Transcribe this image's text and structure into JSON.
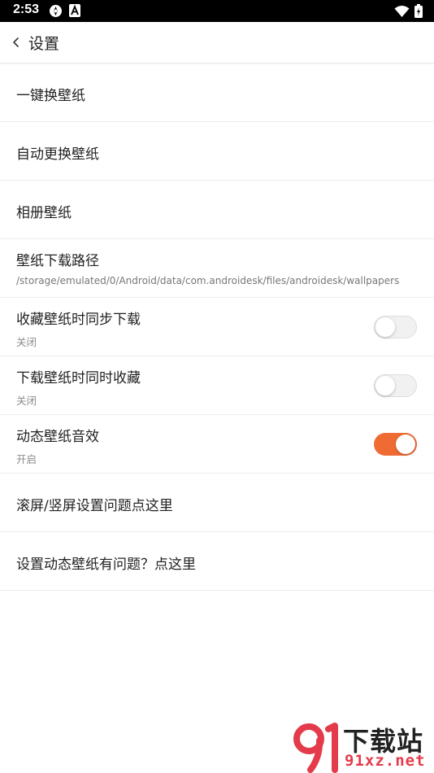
{
  "status_bar": {
    "time": "2:53",
    "left_icons": [
      "sync-icon",
      "app-a-icon"
    ],
    "right_icons": [
      "wifi-icon",
      "battery-charging-icon"
    ]
  },
  "header": {
    "title": "设置",
    "back_icon": "chevron-left-icon"
  },
  "settings": {
    "items": [
      {
        "title": "一键换壁纸"
      },
      {
        "title": "自动更换壁纸"
      },
      {
        "title": "相册壁纸"
      },
      {
        "title": "壁纸下载路径",
        "subtitle": "/storage/emulated/0/Android/data/com.androidesk/files/androidesk/wallpapers"
      },
      {
        "title": "收藏壁纸时同步下载",
        "subtitle": "关闭",
        "toggle": false
      },
      {
        "title": "下载壁纸时同时收藏",
        "subtitle": "关闭",
        "toggle": false
      },
      {
        "title": "动态壁纸音效",
        "subtitle": "开启",
        "toggle": true
      },
      {
        "title": "滚屏/竖屏设置问题点这里"
      },
      {
        "title": "设置动态壁纸有问题？点这里"
      }
    ]
  },
  "watermark": {
    "logo_text": "91",
    "title": "下载站",
    "url": "91xz.net"
  },
  "colors": {
    "accent": "#f06a34",
    "watermark_red": "#e43b4b",
    "divider": "#eeeeee"
  }
}
